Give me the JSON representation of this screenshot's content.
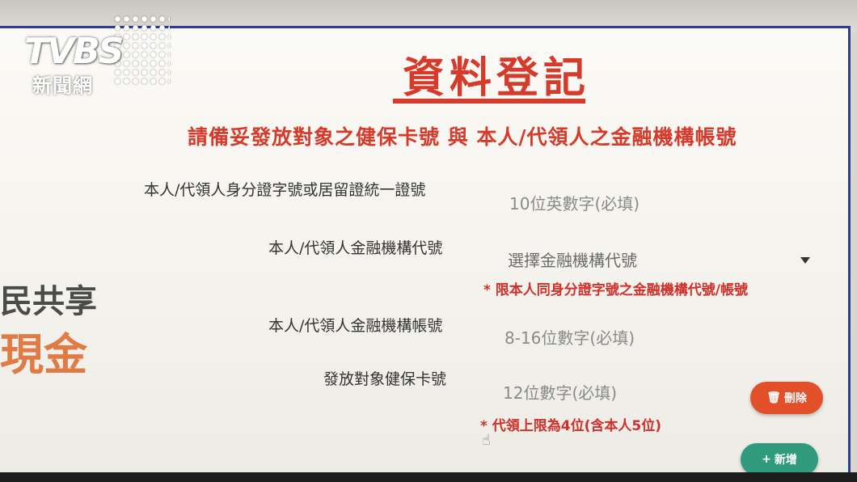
{
  "watermark": {
    "brand": "TVBS",
    "subtitle": "新聞網"
  },
  "left_banner": {
    "line1": "民共享",
    "line2": "現金"
  },
  "form": {
    "title": "資料登記",
    "subtitle": "請備妥發放對象之健保卡號 與 本人/代領人之金融機構帳號",
    "fields": [
      {
        "label": "本人/代領人身分證字號或居留證統一證號",
        "placeholder": "10位英數字(必填)"
      },
      {
        "label": "本人/代領人金融機構代號",
        "placeholder": "選擇金融機構代號"
      },
      {
        "label": "本人/代領人金融機構帳號",
        "placeholder": "8-16位數字(必填)"
      },
      {
        "label": "發放對象健保卡號",
        "placeholder": "12位數字(必填)"
      }
    ],
    "bank_note": "* 限本人同身分證字號之金融機構代號/帳號",
    "limit_note": "* 代領上限為4位(含本人5位)",
    "delete_button": "刪除",
    "add_button": "新增"
  },
  "icons": {
    "delete": "trash-icon",
    "add": "plus-icon",
    "select": "caret-down-icon",
    "cursor": "hand-pointer-icon"
  },
  "colors": {
    "accent_red": "#d63a2b",
    "delete_button": "#e2502a",
    "add_button": "#2f9a7c",
    "screen_border": "#2c3c9a"
  }
}
